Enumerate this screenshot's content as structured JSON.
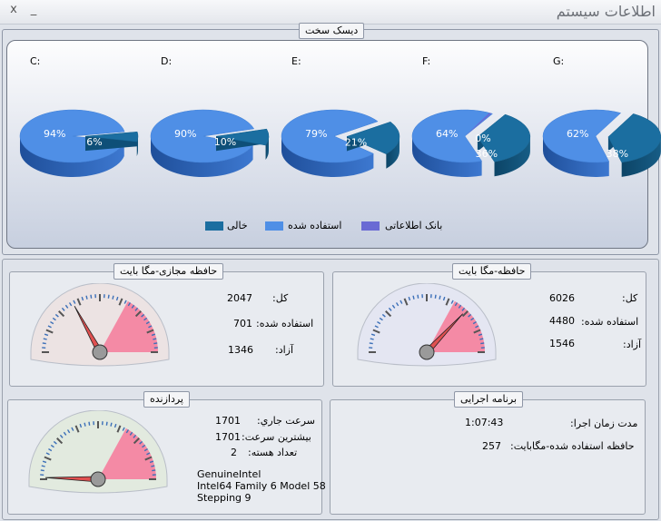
{
  "window": {
    "title": "اطلاعات سیستم",
    "close_glyph": "x",
    "minimize_glyph": "_"
  },
  "disk": {
    "group_title": "دیسک سخت",
    "legend": {
      "empty": "خالی",
      "used": "استفاده شده",
      "unavailable": "بانک اطلاعاتی"
    },
    "colors": {
      "used": "#4f8fe6",
      "empty": "#1b6ea0",
      "unavailable": "#6a6ad4"
    }
  },
  "chart_data": {
    "type": "pie",
    "charts": [
      {
        "drive": "C:",
        "used": 94,
        "empty": 6,
        "unavailable": null,
        "labels": [
          "94%",
          "6%"
        ]
      },
      {
        "drive": "D:",
        "used": 90,
        "empty": 10,
        "unavailable": null,
        "labels": [
          "90%",
          "10%"
        ]
      },
      {
        "drive": "E:",
        "used": 79,
        "empty": 21,
        "unavailable": null,
        "labels": [
          "79%",
          "21%"
        ]
      },
      {
        "drive": "F:",
        "used": 64,
        "empty": 36,
        "unavailable": 0,
        "labels": [
          "64%",
          "36%",
          "0%"
        ]
      },
      {
        "drive": "G:",
        "used": 62,
        "empty": 38,
        "unavailable": null,
        "labels": [
          "62%",
          "38%"
        ]
      }
    ]
  },
  "virtual_memory": {
    "title": "حافظه مجازی-مگا بایت",
    "total_label": "کل:",
    "total": "2047",
    "used_label": "استفاده شده:",
    "used": "701",
    "free_label": "آزاد:",
    "free": "1346",
    "gauge_fraction": 0.34
  },
  "memory": {
    "title": "حافظه-مگا بایت",
    "total_label": "کل:",
    "total": "6026",
    "used_label": "استفاده شده:",
    "used": "4480",
    "free_label": "آزاد:",
    "free": "1546",
    "gauge_fraction": 0.74
  },
  "processor": {
    "title": "پردازنده",
    "current_speed_label": "سرعت جاري:",
    "current_speed": "1701",
    "max_speed_label": "بیشترین سرعت:",
    "max_speed": "1701",
    "cores_label": "تعداد هسته:",
    "cores": "2",
    "vendor": "GenuineIntel",
    "model": "Intel64 Family 6 Model 58",
    "stepping": "Stepping 9",
    "gauge_fraction": 0.01
  },
  "program": {
    "title": "برنامه اجرایی",
    "uptime_label": "مدت زمان اجرا:",
    "uptime": "1:07:43",
    "mem_label": "حافظه استفاده شده-مگابایت:",
    "mem": "257"
  }
}
